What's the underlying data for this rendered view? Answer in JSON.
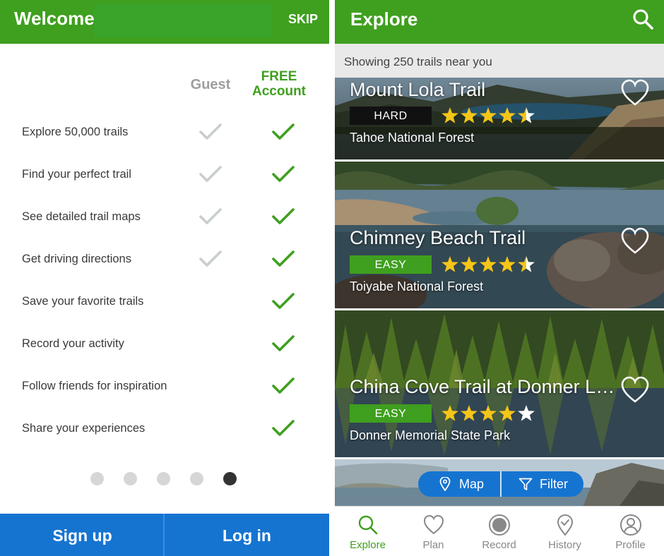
{
  "welcome": {
    "header": {
      "title": "Welcome",
      "skip_label": "SKIP"
    },
    "columns": {
      "guest": "Guest",
      "free_line1": "FREE",
      "free_line2": "Account"
    },
    "features": [
      {
        "label": "Explore 50,000 trails",
        "guest": true,
        "free": true
      },
      {
        "label": "Find your perfect trail",
        "guest": true,
        "free": true
      },
      {
        "label": "See detailed trail maps",
        "guest": true,
        "free": true
      },
      {
        "label": "Get driving directions",
        "guest": true,
        "free": true
      },
      {
        "label": "Save your favorite trails",
        "guest": false,
        "free": true
      },
      {
        "label": "Record your activity",
        "guest": false,
        "free": true
      },
      {
        "label": "Follow friends for inspiration",
        "guest": false,
        "free": true
      },
      {
        "label": "Share your experiences",
        "guest": false,
        "free": true
      }
    ],
    "pager": {
      "count": 5,
      "active_index": 4
    },
    "footer": {
      "signup_label": "Sign up",
      "login_label": "Log in"
    }
  },
  "explore": {
    "header": {
      "title": "Explore",
      "search_icon": "search-icon"
    },
    "summary": "Showing 250 trails near you",
    "trails": [
      {
        "name": "Mount Lola Trail",
        "difficulty": "HARD",
        "rating": 4.5,
        "area": "Tahoe National Forest"
      },
      {
        "name": "Chimney Beach Trail",
        "difficulty": "EASY",
        "rating": 4.5,
        "area": "Toiyabe National Forest"
      },
      {
        "name": "China Cove Trail at Donner Lake Loop",
        "difficulty": "EASY",
        "rating": 4,
        "area": "Donner Memorial State Park"
      }
    ],
    "actions": {
      "map_label": "Map",
      "filter_label": "Filter"
    },
    "tabs": [
      {
        "label": "Explore",
        "icon": "search-icon",
        "active": true
      },
      {
        "label": "Plan",
        "icon": "heart-icon",
        "active": false
      },
      {
        "label": "Record",
        "icon": "record-icon",
        "active": false
      },
      {
        "label": "History",
        "icon": "location-check-icon",
        "active": false
      },
      {
        "label": "Profile",
        "icon": "profile-icon",
        "active": false
      }
    ]
  },
  "colors": {
    "brand_green": "#3f9f1f",
    "action_blue": "#1674d1",
    "guest_check": "#c8cdd0",
    "star_yellow": "#f5c518",
    "hard_badge": "#111111"
  }
}
